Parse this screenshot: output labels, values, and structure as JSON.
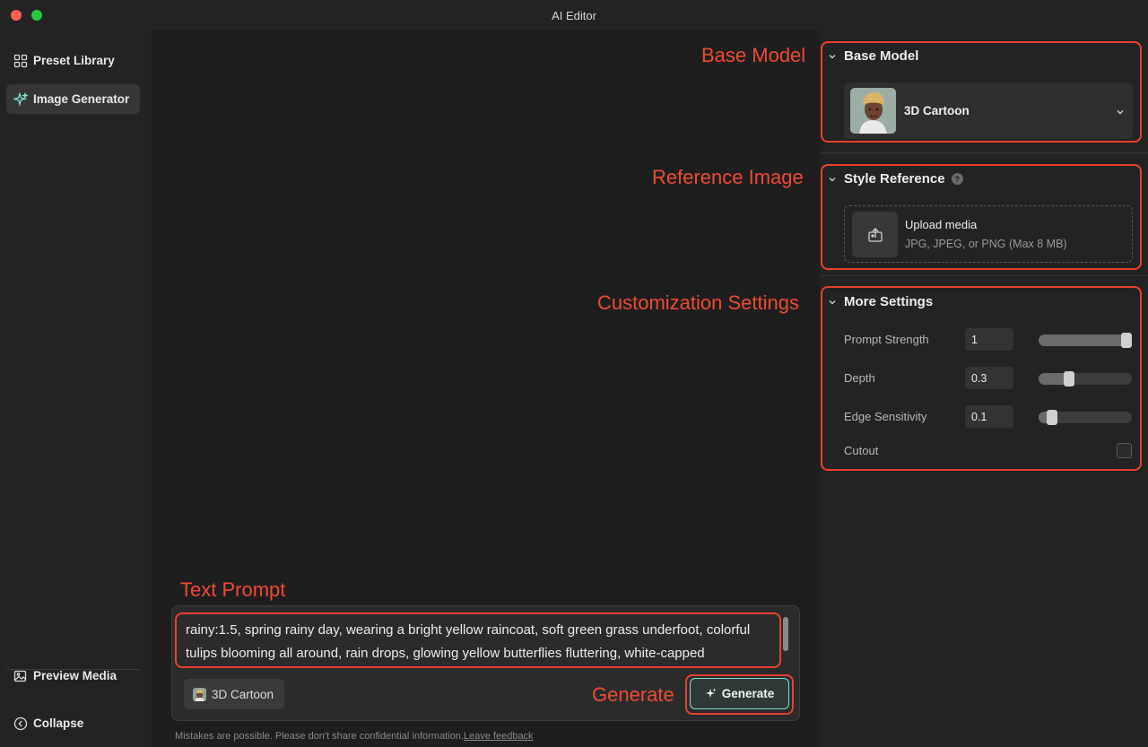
{
  "window": {
    "title": "AI Editor"
  },
  "sidebar": {
    "items": [
      {
        "label": "Preset Library",
        "icon": "grid-icon"
      },
      {
        "label": "Image Generator",
        "icon": "sparkle-icon",
        "active": true
      }
    ],
    "bottom": [
      {
        "label": "Preview Media",
        "icon": "image-icon"
      },
      {
        "label": "Collapse",
        "icon": "chevron-left-circle-icon"
      }
    ]
  },
  "base_model": {
    "header": "Base Model",
    "selected": "3D Cartoon"
  },
  "style_reference": {
    "header": "Style Reference",
    "help": "?",
    "upload_title": "Upload media",
    "upload_sub": "JPG, JPEG, or PNG (Max 8 MB)"
  },
  "more_settings": {
    "header": "More Settings",
    "prompt_strength": {
      "label": "Prompt Strength",
      "value": "1",
      "fraction": 1.0
    },
    "depth": {
      "label": "Depth",
      "value": "0.3",
      "fraction": 0.3
    },
    "edge_sensitivity": {
      "label": "Edge Sensitivity",
      "value": "0.1",
      "fraction": 0.1
    },
    "cutout": {
      "label": "Cutout",
      "checked": false
    }
  },
  "prompt": {
    "text": "rainy:1.5, spring rainy day, wearing a bright yellow raincoat, soft green grass underfoot, colorful tulips blooming all around, rain drops, glowing yellow butterflies fluttering, white-capped",
    "chip_label": "3D Cartoon",
    "generate_label": "Generate"
  },
  "footer": {
    "note": "Mistakes are possible. Please don't share confidential information.",
    "link": "Leave feedback"
  },
  "annotations": {
    "base_model": "Base Model",
    "reference_image": "Reference Image",
    "customization": "Customization Settings",
    "text_prompt": "Text Prompt",
    "generate": "Generate"
  },
  "colors": {
    "accent": "#7fe0cf",
    "annotation": "#e8402f",
    "background": "#232323",
    "canvas": "#1e1e1e"
  }
}
